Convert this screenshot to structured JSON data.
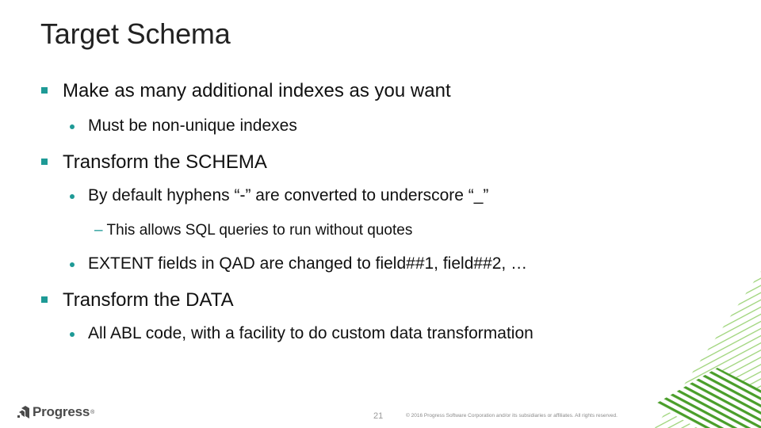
{
  "slide": {
    "title": "Target Schema",
    "bullets": [
      {
        "level": 1,
        "text": "Make as many additional indexes as you want"
      },
      {
        "level": 2,
        "text": "Must be non-unique indexes"
      },
      {
        "level": 1,
        "text": "Transform the SCHEMA"
      },
      {
        "level": 2,
        "text": "By default hyphens “-” are converted to underscore “_”"
      },
      {
        "level": 3,
        "text": "This allows SQL queries to run without quotes"
      },
      {
        "level": 2,
        "text": "EXTENT fields in QAD are changed to field##1, field##2, …"
      },
      {
        "level": 1,
        "text": "Transform the DATA"
      },
      {
        "level": 2,
        "text": "All ABL code, with a facility to do custom data transformation"
      }
    ],
    "level3_marker": "–"
  },
  "footer": {
    "logo_text": "Progress",
    "logo_reg": "®",
    "page_number": "21",
    "copyright": "© 2016 Progress Software Corporation and/or its subsidiaries or affiliates. All rights reserved."
  },
  "colors": {
    "bullet_accent": "#1e9a96",
    "stripe_dark": "#4a9e2a",
    "stripe_light": "#9ed47a"
  }
}
